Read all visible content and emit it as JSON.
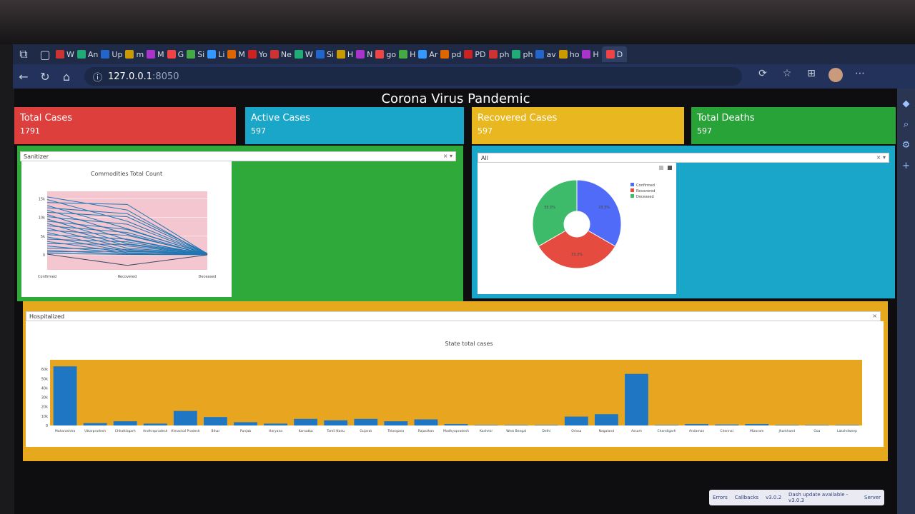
{
  "browser": {
    "tabs": [
      "W",
      "An",
      "Up",
      "m",
      "M",
      "G",
      "Si",
      "Li",
      "M",
      "Yo",
      "Ne",
      "W",
      "Si",
      "H",
      "N",
      "go",
      "H",
      "Ar",
      "pd",
      "PD",
      "ph",
      "ph",
      "av",
      "ho",
      "H",
      "D"
    ],
    "url_host": "127.0.0.1",
    "url_port": ":8050"
  },
  "page": {
    "title": "Corona Virus Pandemic"
  },
  "cards": [
    {
      "label": "Total Cases",
      "value": "1791",
      "color": "#dd3f3c"
    },
    {
      "label": "Active Cases",
      "value": "597",
      "color": "#1aa6c9"
    },
    {
      "label": "Recovered Cases",
      "value": "597",
      "color": "#e9b71f"
    },
    {
      "label": "Total Deaths",
      "value": "597",
      "color": "#28a338"
    }
  ],
  "left_panel": {
    "dropdown_value": "Sanitizer",
    "bg": "#2ea93a"
  },
  "right_panel": {
    "dropdown_value": "All",
    "bg": "#1aa6c9"
  },
  "bottom_panel": {
    "dropdown_value": "Hospitalized",
    "bg": "#e6a81c"
  },
  "chart_data": [
    {
      "type": "line",
      "title": "Commodities Total Count",
      "categories": [
        "Confirmed",
        "Recovered",
        "Deceased"
      ],
      "yticks": [
        "0",
        "5k",
        "10k",
        "15k"
      ],
      "ylim": [
        0,
        17000
      ],
      "series": [
        {
          "values": [
            15500,
            12000,
            0
          ]
        },
        {
          "values": [
            14800,
            9000,
            200
          ]
        },
        {
          "values": [
            14000,
            13500,
            300
          ]
        },
        {
          "values": [
            13200,
            7000,
            100
          ]
        },
        {
          "values": [
            12600,
            11000,
            400
          ]
        },
        {
          "values": [
            12000,
            5500,
            0
          ]
        },
        {
          "values": [
            11400,
            10200,
            250
          ]
        },
        {
          "values": [
            10800,
            4000,
            150
          ]
        },
        {
          "values": [
            10200,
            8200,
            50
          ]
        },
        {
          "values": [
            9600,
            3000,
            300
          ]
        },
        {
          "values": [
            9000,
            6800,
            200
          ]
        },
        {
          "values": [
            8400,
            2400,
            100
          ]
        },
        {
          "values": [
            7800,
            6000,
            0
          ]
        },
        {
          "values": [
            7200,
            1800,
            350
          ]
        },
        {
          "values": [
            6600,
            5200,
            200
          ]
        },
        {
          "values": [
            6000,
            1200,
            100
          ]
        },
        {
          "values": [
            5400,
            4200,
            50
          ]
        },
        {
          "values": [
            4800,
            900,
            250
          ]
        },
        {
          "values": [
            4200,
            3500,
            150
          ]
        },
        {
          "values": [
            3600,
            600,
            0
          ]
        },
        {
          "values": [
            3000,
            2800,
            100
          ]
        },
        {
          "values": [
            2400,
            400,
            300
          ]
        },
        {
          "values": [
            1800,
            1500,
            200
          ]
        },
        {
          "values": [
            1200,
            200,
            100
          ]
        },
        {
          "values": [
            800,
            1000,
            400
          ]
        },
        {
          "values": [
            400,
            100,
            50
          ]
        },
        {
          "values": [
            200,
            -2800,
            0
          ]
        }
      ]
    },
    {
      "type": "pie",
      "legend": [
        "Confirmed",
        "Recovered",
        "Deceased"
      ],
      "values": [
        33.3,
        33.3,
        33.3
      ],
      "labels": [
        "33.3%",
        "33.3%",
        "33.3%"
      ],
      "colors": [
        "#4f6bf7",
        "#e64b3f",
        "#3dbb6a"
      ]
    },
    {
      "type": "bar",
      "title": "State total cases",
      "categories": [
        "Maharashtra",
        "Uttarpradesh",
        "Chhattisgarh",
        "Andhrapradesh",
        "Himachal Pradesh",
        "Bihar",
        "Punjab",
        "Haryana",
        "Karnatka",
        "Tamil Nadu",
        "Gujarat",
        "Telangana",
        "Rajasthan",
        "Madhyapradesh",
        "Kashmir",
        "West Bengal",
        "Delhi",
        "Orissa",
        "Nagaland",
        "Assam",
        "Chandigarh",
        "Andaman",
        "Chennai",
        "Mizoram",
        "Jharkhand",
        "Goa",
        "Lakshdweep"
      ],
      "values": [
        63000,
        2500,
        4500,
        2000,
        15500,
        9000,
        3500,
        2000,
        7000,
        5500,
        7000,
        4500,
        6500,
        1500,
        500,
        500,
        500,
        9500,
        12000,
        55000,
        500,
        1500,
        1000,
        1500,
        500,
        500,
        500
      ],
      "yticks": [
        "0",
        "10k",
        "20k",
        "30k",
        "40k",
        "50k",
        "60k"
      ],
      "ylim": [
        0,
        70000
      ]
    }
  ],
  "devtools": {
    "errors": "Errors",
    "callbacks": "Callbacks",
    "version": "v3.0.2",
    "update": "Dash update available - v3.0.3",
    "server": "Server"
  }
}
